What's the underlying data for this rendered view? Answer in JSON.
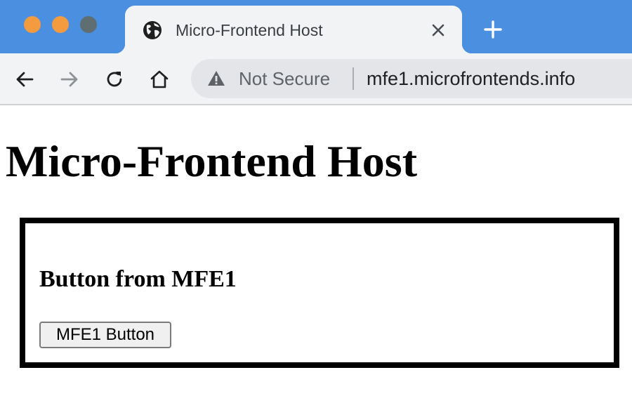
{
  "browser": {
    "tab": {
      "title": "Micro-Frontend Host",
      "icon": "globe-icon"
    },
    "new_tab_icon": "plus-icon",
    "nav": [
      "back-arrow-icon",
      "forward-arrow-icon",
      "reload-icon",
      "home-icon"
    ],
    "address_bar": {
      "security_label": "Not Secure",
      "security_icon": "warning-triangle-icon",
      "url": "mfe1.microfrontends.info"
    },
    "colors": {
      "tabstrip": "#4a8fe0",
      "toolbar": "#f2f3f5",
      "omnibox": "#e3e5e8"
    }
  },
  "page": {
    "title": "Micro-Frontend Host",
    "mfe": {
      "heading": "Button from MFE1",
      "button_label": "MFE1 Button"
    }
  }
}
